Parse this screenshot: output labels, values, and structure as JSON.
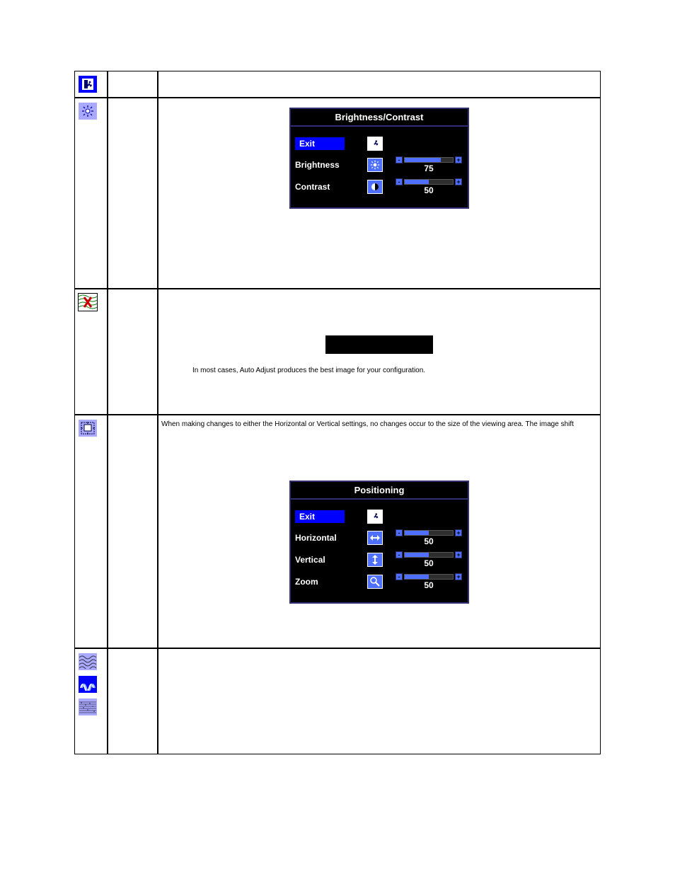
{
  "row3": {
    "note": "In most cases, Auto Adjust produces the best image for your configuration."
  },
  "row4": {
    "desc": "When making changes to either the Horizontal or Vertical settings, no changes occur to the size of the viewing area. The image shift"
  },
  "osd_bc": {
    "title": "Brightness/Contrast",
    "exit": "Exit",
    "brightness_label": "Brightness",
    "brightness_value": "75",
    "contrast_label": "Contrast",
    "contrast_value": "50"
  },
  "osd_pos": {
    "title": "Positioning",
    "exit": "Exit",
    "horizontal_label": "Horizontal",
    "horizontal_value": "50",
    "vertical_label": "Vertical",
    "vertical_value": "50",
    "zoom_label": "Zoom",
    "zoom_value": "50"
  },
  "icons": {
    "exit": "exit-run-icon",
    "brightness": "sun-icon",
    "autoadjust": "auto-adjust-icon",
    "positioning": "positioning-icon",
    "contrast": "contrast-icon",
    "horiz": "horizontal-arrows-icon",
    "vert": "vertical-arrows-icon",
    "zoom": "magnifier-icon",
    "pixel": "pixel-clock-icon",
    "phase": "phase-icon",
    "noise": "noise-icon"
  }
}
